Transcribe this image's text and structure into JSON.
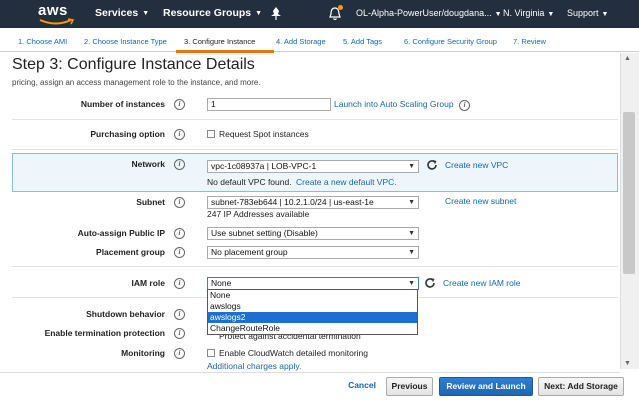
{
  "nav": {
    "brand": "aws",
    "services": "Services",
    "resource_groups": "Resource Groups",
    "account": "OL-Alpha-PowerUser/dougdana...",
    "region": "N. Virginia",
    "support": "Support",
    "caret": "⌄"
  },
  "steps": [
    {
      "label": "1. Choose AMI"
    },
    {
      "label": "2. Choose Instance Type"
    },
    {
      "label": "3. Configure Instance"
    },
    {
      "label": "4. Add Storage"
    },
    {
      "label": "5. Add Tags"
    },
    {
      "label": "6. Configure Security Group"
    },
    {
      "label": "7. Review"
    }
  ],
  "title": "Step 3: Configure Instance Details",
  "subtitle": "pricing, assign an access management role to the instance, and more.",
  "info": "i",
  "fields": {
    "instances": {
      "label": "Number of instances",
      "value": "1",
      "link": "Launch into Auto Scaling Group"
    },
    "purchasing": {
      "label": "Purchasing option",
      "checkbox": "Request Spot instances"
    },
    "network": {
      "label": "Network",
      "value": "vpc-1c08937a | LOB-VPC-1",
      "link": "Create new VPC",
      "note": "No default VPC found.",
      "note_link": "Create a new default VPC."
    },
    "subnet": {
      "label": "Subnet",
      "value": "subnet-783eb644 | 10.2.1.0/24 | us-east-1e",
      "link": "Create new subnet",
      "note": "247 IP Addresses available"
    },
    "public_ip": {
      "label": "Auto-assign Public IP",
      "value": "Use subnet setting (Disable)"
    },
    "placement": {
      "label": "Placement group",
      "value": "No placement group"
    },
    "iam": {
      "label": "IAM role",
      "value": "None",
      "link": "Create new IAM role",
      "options": [
        "None",
        "awslogs",
        "awslogs2",
        "ChangeRouteRole"
      ],
      "highlighted": "awslogs2"
    },
    "shutdown": {
      "label": "Shutdown behavior"
    },
    "termination": {
      "label": "Enable termination protection",
      "checkbox_partial": "Protect against accidental termination"
    },
    "monitoring": {
      "label": "Monitoring",
      "checkbox": "Enable CloudWatch detailed monitoring",
      "link": "Additional charges apply."
    }
  },
  "footer": {
    "cancel": "Cancel",
    "previous": "Previous",
    "review": "Review and Launch",
    "next": "Next: Add Storage"
  },
  "colors": {
    "nav_bg": "#232f3e",
    "link": "#1666af",
    "accent_orange": "#e47911",
    "primary_button": "#1e66b7",
    "dropdown_highlight": "#1e6fcf"
  }
}
